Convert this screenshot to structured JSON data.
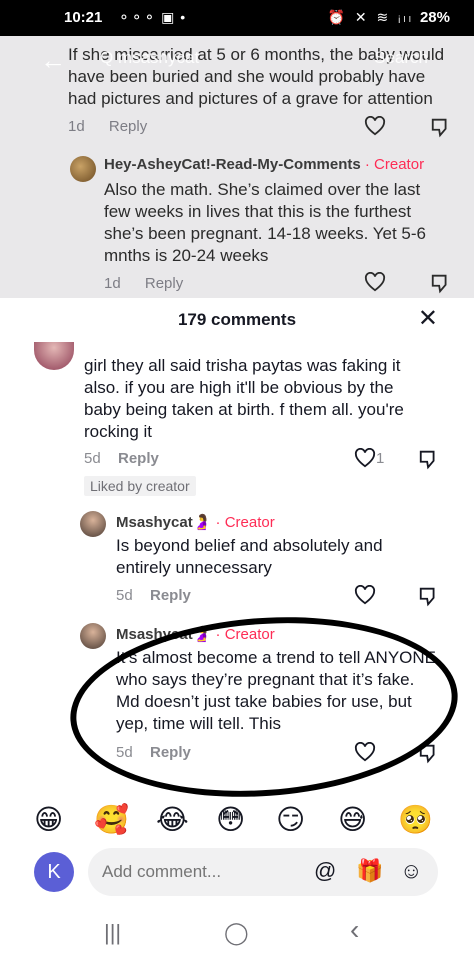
{
  "status_bar": {
    "time": "10:21",
    "left_icons": "⚬⚬⚬ ▣ •",
    "right_icons": "⏰ ✕ ≋ ᵢₗₗ",
    "battery": "28%"
  },
  "top": {
    "search_overlay": "Q msashycat",
    "search_button": "Search",
    "comment_text": "If she miscarried at 5 or 6 months, the baby would have been buried and she would probably have had pictures and pictures of a grave for attention",
    "comment_date": "1d",
    "comment_reply": "Reply",
    "reply_author": "Hey-AsheyCat!-Read-My-Comments",
    "reply_creator": " · Creator",
    "reply_text": "Also the math. She’s claimed over the last few weeks in lives that this is the furthest she’s been pregnant. 14-18 weeks. Yet 5-6 mnths is 20-24 weeks",
    "reply_date": "1d",
    "reply_reply": "Reply"
  },
  "sheet": {
    "title": "179 comments",
    "close_icon": "✕",
    "comments": [
      {
        "text": "girl they all said trisha paytas was faking it also. if you are high it'll be obvious by the baby being taken at birth. f them all. you're rocking it",
        "date": "5d",
        "reply": "Reply",
        "likes": "1",
        "liked_by_creator": "Liked by creator"
      },
      {
        "author": "Msashycat🤰",
        "creator": " · Creator",
        "text": "Is beyond belief and absolutely and entirely unnecessary",
        "date": "5d",
        "reply": "Reply"
      },
      {
        "author": "Msashycat🤰",
        "creator": " · Creator",
        "text": "It’s almost become a trend to tell ANYONE who says they’re pregnant that it’s fake. Md doesn’t just take babies for use, but yep, time will tell. This",
        "date": "5d",
        "reply": "Reply"
      }
    ]
  },
  "emoji_row": [
    "😁",
    "🥰",
    "😂",
    "😳",
    "😏",
    "😅",
    "🥺"
  ],
  "input": {
    "avatar_letter": "K",
    "placeholder": "Add comment...",
    "at_icon": "@",
    "gift_icon": "🎁",
    "emoji_icon": "☺"
  },
  "nav": {
    "recents": "|||",
    "home": "◯",
    "back": "‹"
  }
}
